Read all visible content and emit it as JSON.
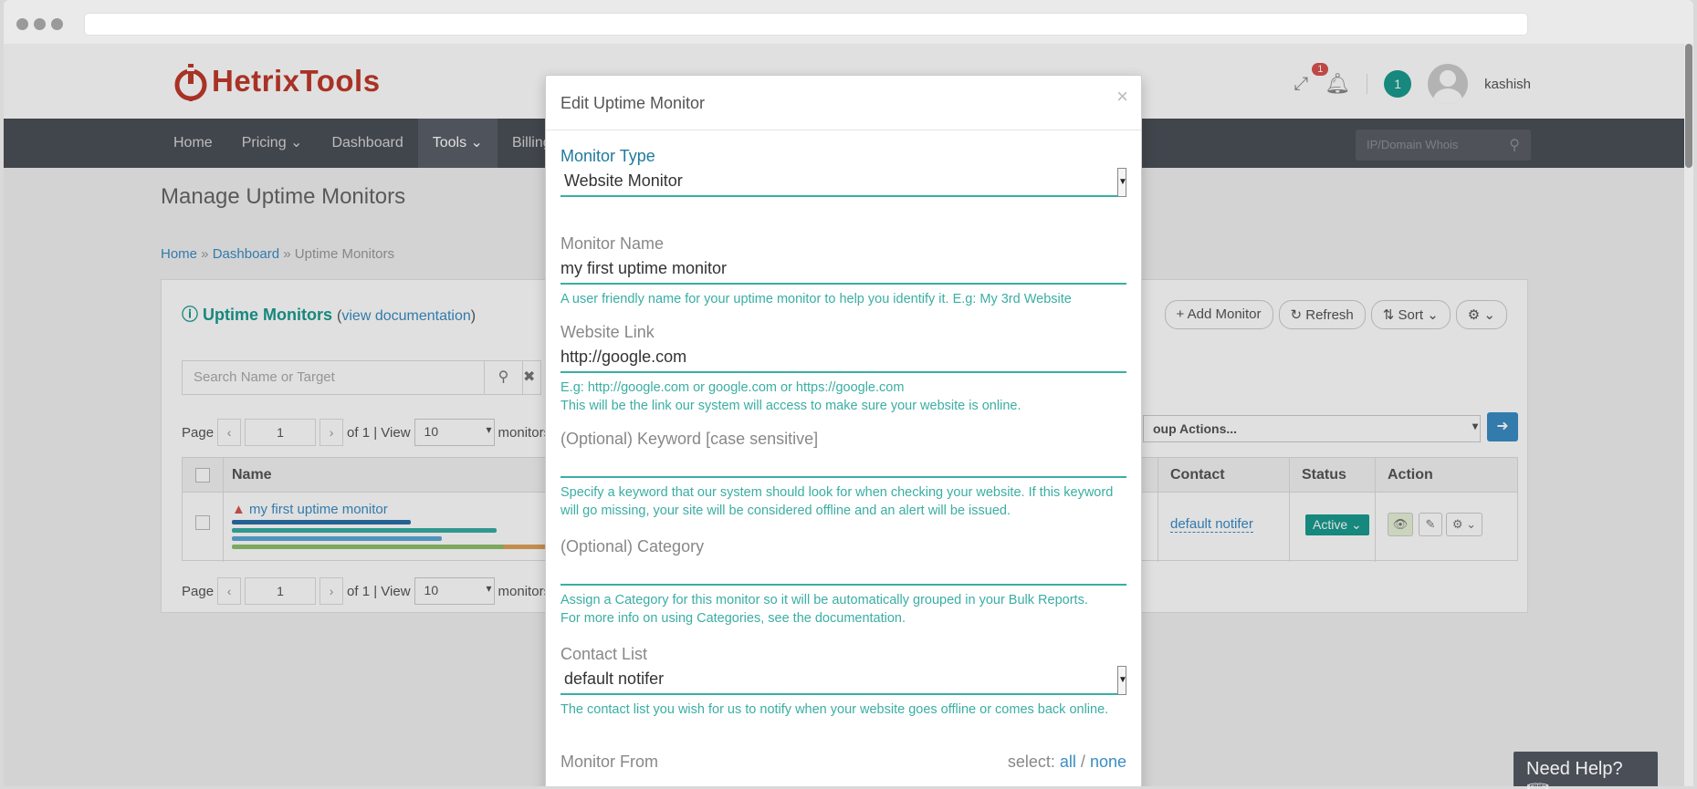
{
  "header": {
    "logo_text": "HetrixTools",
    "notification_count": "1",
    "status_count": "1",
    "username": "kashish"
  },
  "nav": {
    "items": [
      {
        "label": "Home"
      },
      {
        "label": "Pricing",
        "caret": "⌄"
      },
      {
        "label": "Dashboard"
      },
      {
        "label": "Tools",
        "caret": "⌄"
      },
      {
        "label": "Billing",
        "caret": "⌄"
      }
    ],
    "search_placeholder": "IP/Domain Whois"
  },
  "page": {
    "title": "Manage Uptime Monitors",
    "breadcrumb": [
      "Home",
      "Dashboard",
      "Uptime Monitors"
    ]
  },
  "panel": {
    "title": "Uptime Monitors",
    "doc_open": "(",
    "doc_link": "view documentation",
    "doc_close": ")",
    "buttons": {
      "add": "Add Monitor",
      "refresh": "Refresh",
      "sort": "Sort"
    },
    "search_placeholder": "Search Name or Target",
    "pager": {
      "page_label": "Page",
      "page_value": "1",
      "of_label": "of 1 | View",
      "view_value": "10",
      "monitors_label": "monitors | T"
    },
    "group_actions": "oup Actions...",
    "table": {
      "headers": {
        "name": "Name",
        "contact": "Contact",
        "status": "Status",
        "action": "Action"
      },
      "rows": [
        {
          "name": "my first uptime monitor",
          "contact": "default notifer",
          "status": "Active"
        }
      ]
    }
  },
  "modal": {
    "title": "Edit Uptime Monitor",
    "monitor_type": {
      "label": "Monitor Type",
      "value": "Website Monitor"
    },
    "monitor_name": {
      "label": "Monitor Name",
      "value": "my first uptime monitor",
      "help": "A user friendly name for your uptime monitor to help you identify it. E.g: My 3rd Website"
    },
    "website_link": {
      "label": "Website Link",
      "value": "http://google.com",
      "help1": "E.g: http://google.com or google.com or https://google.com",
      "help2": "This will be the link our system will access to make sure your website is online."
    },
    "keyword": {
      "label": "(Optional) Keyword [case sensitive]",
      "value": "",
      "help": "Specify a keyword that our system should look for when checking your website. If this keyword will go missing, your site will be considered offline and an alert will be issued."
    },
    "category": {
      "label": "(Optional) Category",
      "value": "",
      "help1": "Assign a Category for this monitor so it will be automatically grouped in your Bulk Reports.",
      "help2": "For more info on using Categories, see the documentation."
    },
    "contact_list": {
      "label": "Contact List",
      "value": "default notifer",
      "help": "The contact list you wish for us to notify when your website goes offline or comes back online."
    },
    "monitor_from": {
      "label": "Monitor From",
      "select_label": "select:",
      "all": "all",
      "sep": "/",
      "none": "none"
    }
  },
  "need_help": "Need Help?",
  "colors": {
    "accent": "#1a9b8f",
    "link": "#3a8dc4",
    "danger": "#d9534f",
    "nav": "#4a4f57"
  }
}
